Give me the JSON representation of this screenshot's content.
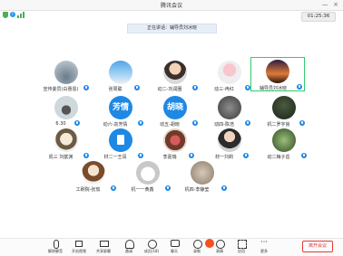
{
  "window": {
    "title": "腾讯会议",
    "minimize_glyph": "—",
    "close_glyph": "×"
  },
  "status": {
    "timer": "01:25:36"
  },
  "speaking": {
    "text": "正在讲话：辅导员刘冰晓"
  },
  "participants": [
    {
      "name": "宣传委员(白惠恩)",
      "avatar_type": "image"
    },
    {
      "name": "张周聪",
      "avatar_type": "image"
    },
    {
      "name": "动二-刘润圈",
      "avatar_type": "image"
    },
    {
      "name": "动三-冉红",
      "avatar_type": "image"
    },
    {
      "name": "辅导员刘冰晓",
      "avatar_type": "image",
      "active": true
    },
    {
      "name": "6.30",
      "avatar_type": "image"
    },
    {
      "name": "动六-袁芳情",
      "avatar_type": "text",
      "avatar_text": "芳情"
    },
    {
      "name": "动五-胡晓",
      "avatar_type": "text",
      "avatar_text": "胡晓"
    },
    {
      "name": "动四-陈浩",
      "avatar_type": "image"
    },
    {
      "name": "机二罗宇良",
      "avatar_type": "image"
    },
    {
      "name": "机三 刘歆渊",
      "avatar_type": "image"
    },
    {
      "name": "材二一王闯",
      "avatar_type": "image"
    },
    {
      "name": "李嘉瑞",
      "avatar_type": "image"
    },
    {
      "name": "材一刘莉",
      "avatar_type": "image"
    },
    {
      "name": "动二梅子岳",
      "avatar_type": "image"
    },
    {
      "name": "工刷院-张茄",
      "avatar_type": "image"
    },
    {
      "name": "机一一黄鑫",
      "avatar_type": "image"
    },
    {
      "name": "机四-李静莹",
      "avatar_type": "image"
    }
  ],
  "toolbar": {
    "items": [
      {
        "label": "解除静音",
        "icon": "mic-muted-icon"
      },
      {
        "label": "开启视频",
        "icon": "camera-off-icon"
      },
      {
        "label": "共享屏幕",
        "icon": "share-screen-icon"
      },
      {
        "label": "邀请",
        "icon": "invite-icon"
      },
      {
        "label": "成员(18)",
        "icon": "members-icon"
      },
      {
        "label": "聊天",
        "icon": "chat-icon"
      },
      {
        "label": "录制",
        "icon": "record-icon"
      },
      {
        "label": "表情",
        "icon": "emoji-icon"
      },
      {
        "label": "应用",
        "icon": "apps-icon"
      },
      {
        "label": "更多",
        "icon": "more-icon"
      }
    ],
    "leave_label": "离开会议"
  },
  "colors": {
    "accent": "#1e88e5",
    "active_border": "#2ecc71",
    "leave": "#e53935"
  }
}
